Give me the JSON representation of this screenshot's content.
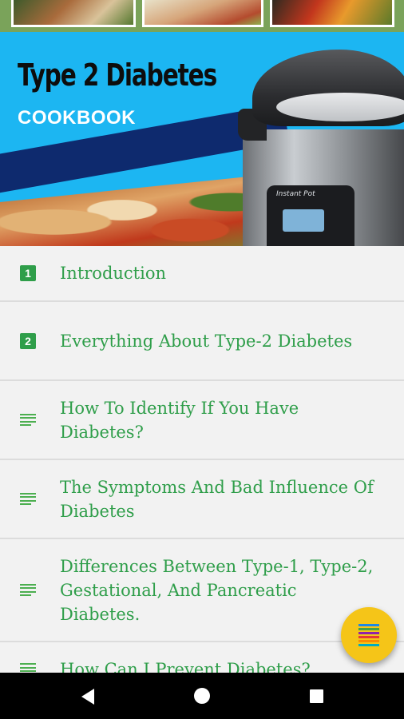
{
  "banner": {
    "title": "Type 2 Diabetes",
    "subtitle": "COOKBOOK",
    "cooker_brand": "Instant Pot"
  },
  "chapters": [
    {
      "icon": "number-1-icon",
      "badge": "1",
      "label": "Introduction"
    },
    {
      "icon": "number-2-icon",
      "badge": "2",
      "label": "Everything About Type-2 Diabetes"
    },
    {
      "icon": "list-lines-icon",
      "label": "How To Identify If You Have Diabetes?"
    },
    {
      "icon": "list-lines-icon",
      "label": "The Symptoms And Bad Influence Of Diabetes"
    },
    {
      "icon": "list-lines-icon",
      "label": "Differences Between Type-1, Type-2, Gestational, And Pancreatic Diabetes."
    },
    {
      "icon": "list-lines-icon",
      "label": "How Can I Prevent Diabetes?"
    }
  ],
  "fab": {
    "icon": "colored-menu-icon"
  },
  "navbar": {
    "back": "back-icon",
    "home": "home-icon",
    "recent": "recent-apps-icon"
  },
  "colors": {
    "accent_green": "#2f9e4a",
    "banner_blue": "#1cb6f2",
    "banner_navy": "#0e2a6e",
    "fab_yellow": "#f5c518",
    "background": "#f2f2f2"
  }
}
